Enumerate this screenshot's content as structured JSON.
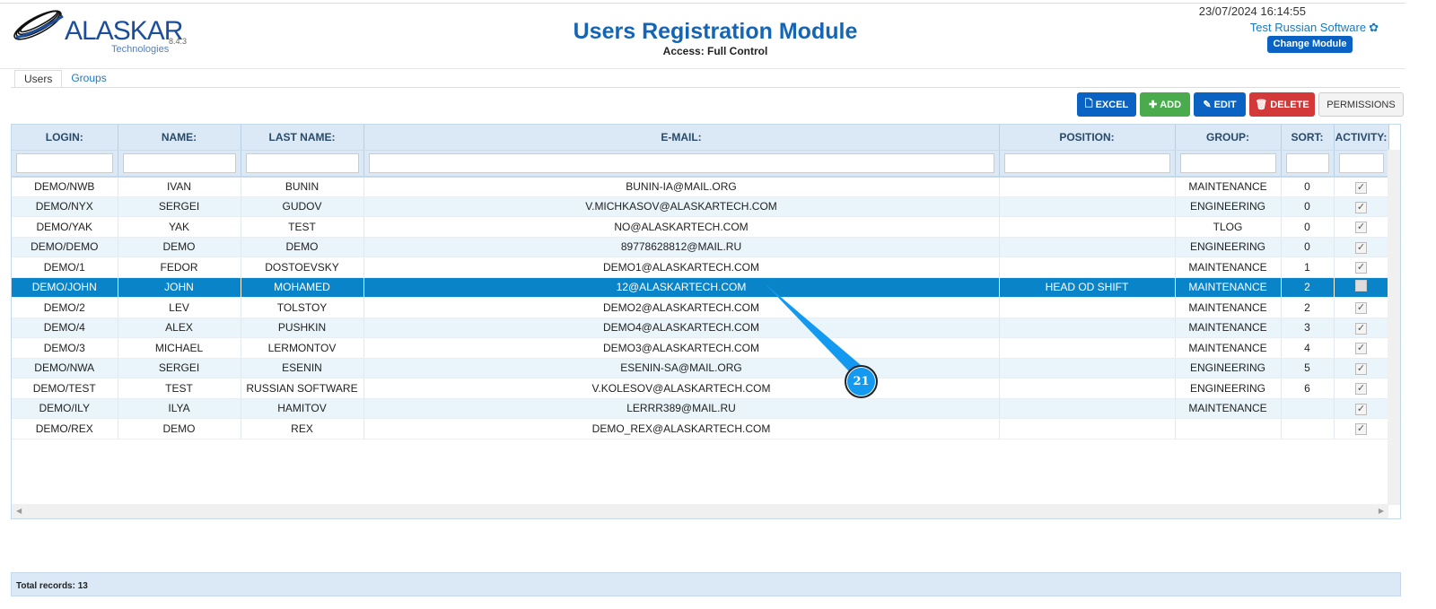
{
  "header": {
    "logo_text": "ALASKAR",
    "logo_sub": "Technologies",
    "version": "8.4.3",
    "title": "Users Registration Module",
    "access": "Access: Full Control",
    "datetime": "23/07/2024 16:14:55",
    "user": "Test Russian Software",
    "change_module": "Change Module"
  },
  "tabs": [
    {
      "label": "Users"
    },
    {
      "label": "Groups"
    }
  ],
  "toolbar": {
    "excel": "EXCEL",
    "add": "ADD",
    "edit": "EDIT",
    "delete": "DELETE",
    "permissions": "PERMISSIONS"
  },
  "columns": [
    "LOGIN:",
    "NAME:",
    "LAST NAME:",
    "E-MAIL:",
    "POSITION:",
    "GROUP:",
    "SORT:",
    "ACTIVITY:"
  ],
  "rows": [
    {
      "login": "DEMO/NWB",
      "name": "IVAN",
      "last": "BUNIN",
      "email": "BUNIN-IA@MAIL.ORG",
      "position": "",
      "group": "MAINTENANCE",
      "sort": "0",
      "active": true
    },
    {
      "login": "DEMO/NYX",
      "name": "SERGEI",
      "last": "GUDOV",
      "email": "V.MICHKASOV@ALASKARTECH.COM",
      "position": "",
      "group": "ENGINEERING",
      "sort": "0",
      "active": true
    },
    {
      "login": "DEMO/YAK",
      "name": "YAK",
      "last": "TEST",
      "email": "NO@ALASKARTECH.COM",
      "position": "",
      "group": "TLOG",
      "sort": "0",
      "active": true
    },
    {
      "login": "DEMO/DEMO",
      "name": "DEMO",
      "last": "DEMO",
      "email": "89778628812@MAIL.RU",
      "position": "",
      "group": "ENGINEERING",
      "sort": "0",
      "active": true
    },
    {
      "login": "DEMO/1",
      "name": "FEDOR",
      "last": "DOSTOEVSKY",
      "email": "DEMO1@ALASKARTECH.COM",
      "position": "",
      "group": "MAINTENANCE",
      "sort": "1",
      "active": true
    },
    {
      "login": "DEMO/JOHN",
      "name": "JOHN",
      "last": "MOHAMED",
      "email": "12@ALASKARTECH.COM",
      "position": "HEAD OD SHIFT",
      "group": "MAINTENANCE",
      "sort": "2",
      "active": false,
      "selected": true
    },
    {
      "login": "DEMO/2",
      "name": "LEV",
      "last": "TOLSTOY",
      "email": "DEMO2@ALASKARTECH.COM",
      "position": "",
      "group": "MAINTENANCE",
      "sort": "2",
      "active": true
    },
    {
      "login": "DEMO/4",
      "name": "ALEX",
      "last": "PUSHKIN",
      "email": "DEMO4@ALASKARTECH.COM",
      "position": "",
      "group": "MAINTENANCE",
      "sort": "3",
      "active": true
    },
    {
      "login": "DEMO/3",
      "name": "MICHAEL",
      "last": "LERMONTOV",
      "email": "DEMO3@ALASKARTECH.COM",
      "position": "",
      "group": "MAINTENANCE",
      "sort": "4",
      "active": true
    },
    {
      "login": "DEMO/NWA",
      "name": "SERGEI",
      "last": "ESENIN",
      "email": "ESENIN-SA@MAIL.ORG",
      "position": "",
      "group": "ENGINEERING",
      "sort": "5",
      "active": true
    },
    {
      "login": "DEMO/TEST",
      "name": "TEST",
      "last": "RUSSIAN SOFTWARE",
      "email": "V.KOLESOV@ALASKARTECH.COM",
      "position": "",
      "group": "ENGINEERING",
      "sort": "6",
      "active": true
    },
    {
      "login": "DEMO/ILY",
      "name": "ILYA",
      "last": "HAMITOV",
      "email": "LERRR389@MAIL.RU",
      "position": "",
      "group": "MAINTENANCE",
      "sort": "",
      "active": true
    },
    {
      "login": "DEMO/REX",
      "name": "DEMO",
      "last": "REX",
      "email": "DEMO_REX@ALASKARTECH.COM",
      "position": "",
      "group": "",
      "sort": "",
      "active": true
    }
  ],
  "footer": {
    "total": "Total records: 13"
  },
  "callout": {
    "label": "21",
    "color": "#1499f0"
  }
}
